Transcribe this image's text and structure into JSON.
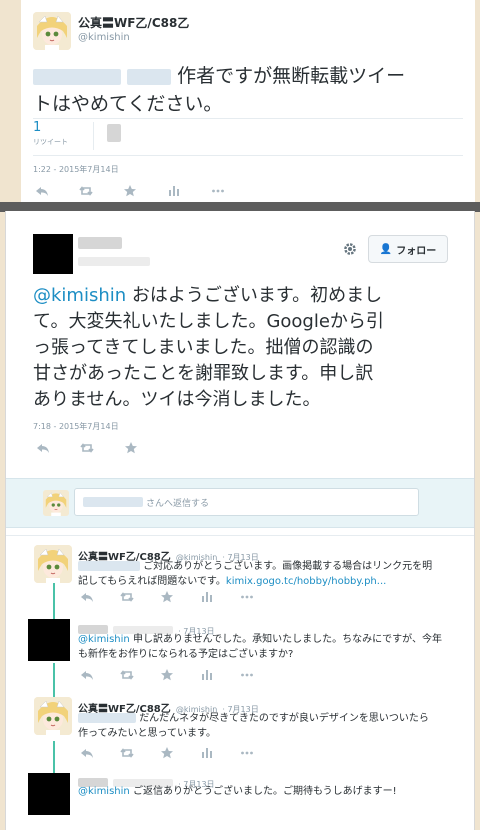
{
  "tweet1": {
    "name": "公真〓WF乙/C88乙",
    "handle": "@kimishin",
    "text_after_mention": "作者ですが無断転載ツイー",
    "text_line2": "トはやめてください。",
    "retweet_count": "1",
    "retweet_label": "リツイート",
    "timestamp": "1:22 - 2015年7月14日"
  },
  "tweet2": {
    "follow_label": "フォロー",
    "mention": "@kimishin",
    "lines": [
      "おはようございます。初めまし",
      "て。大変失礼いたしました。Googleから引",
      "っ張ってきてしまいました。拙僧の認識の",
      "甘さがあったことを謝罪致します。申し訳",
      "ありません。ツイは今消しました。"
    ],
    "timestamp": "7:18 - 2015年7月14日",
    "reply_placeholder_suffix": "さんへ返信する"
  },
  "replies": [
    {
      "name": "公真〓WF乙/C88乙",
      "handle": "@kimishin",
      "date": "· 7月13日",
      "line1": "ご対応ありがとうございます。画像掲載する場合はリンク元を明",
      "line2_prefix": "記してもらえれば問題ないです。",
      "link": "kimix.gogo.tc/hobby/hobby.ph..."
    },
    {
      "date": "· 7月13日",
      "mention": "@kimishin",
      "line1": "申し訳ありませんでした。承知いたしました。ちなみにですが、今年",
      "line2": "も新作をお作りになられる予定はございますか?"
    },
    {
      "name": "公真〓WF乙/C88乙",
      "handle": "@kimishin",
      "date": "· 7月13日",
      "line1": "だんだんネタが尽きてきたのですが良いデザインを思いついたら",
      "line2": "作ってみたいと思っています。"
    },
    {
      "date": "· 7月13日",
      "mention": "@kimishin",
      "line1": "ご返信ありがとうございました。ご期待もうしあげますー!"
    }
  ],
  "icons": {
    "reply": "reply-icon",
    "retweet": "retweet-icon",
    "favorite": "star-icon",
    "stats": "stats-icon",
    "more": "more-icon",
    "settings": "gear-icon",
    "follow": "add-user-icon"
  },
  "colors": {
    "link": "#1d8ec4",
    "thread": "#4ac2a8",
    "muted": "#8899a6"
  }
}
